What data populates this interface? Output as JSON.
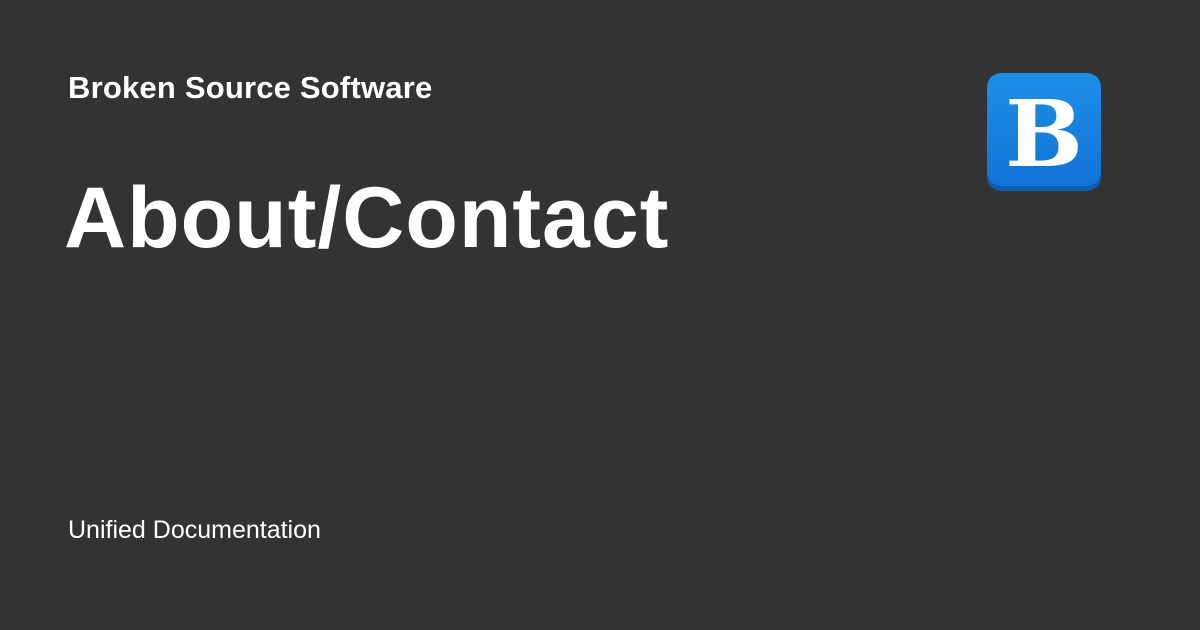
{
  "header": {
    "site_name": "Broken Source Software"
  },
  "main": {
    "page_title": "About/Contact"
  },
  "footer": {
    "text": "Unified Documentation"
  },
  "logo": {
    "icon": "b-logo-icon",
    "letter": "B",
    "colors": {
      "top": "#1e8fe8",
      "bottom": "#1173d6",
      "shadow": "#0b5fae",
      "letter": "#ffffff"
    }
  },
  "colors": {
    "background": "#333333",
    "text": "#ffffff"
  }
}
